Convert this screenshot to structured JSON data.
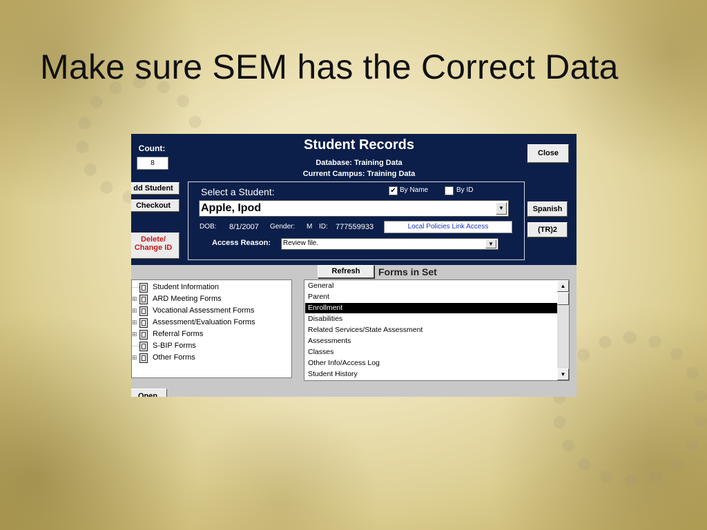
{
  "slide": {
    "title": "Make sure SEM has the Correct Data"
  },
  "app": {
    "count_label": "Count:",
    "count_value": "8",
    "title": "Student Records",
    "database_line": "Database:  Training Data",
    "campus_line": "Current Campus:  Training Data",
    "buttons": {
      "close": "Close",
      "add_student": "dd Student",
      "checkout": "Checkout",
      "delete_line1": "Delete/",
      "delete_line2": "Change ID",
      "spanish": "Spanish",
      "tr2": "(TR)2",
      "refresh": "Refresh",
      "open": "Open"
    },
    "select_student": {
      "label": "Select a Student:",
      "by_name_label": "By Name",
      "by_name_checked": true,
      "by_id_label": "By ID",
      "by_id_checked": false,
      "selected": "Apple, Ipod"
    },
    "student_info": {
      "dob_label": "DOB:",
      "dob_value": "8/1/2007",
      "gender_label": "Gender:",
      "gender_value": "M",
      "id_label": "ID:",
      "id_value": "777559933",
      "link_text": "Local Policies Link Access"
    },
    "access_reason": {
      "label": "Access Reason:",
      "value": "Review file."
    },
    "tree": [
      {
        "label": "Student Information"
      },
      {
        "label": "ARD Meeting Forms"
      },
      {
        "label": "Vocational Assessment Forms"
      },
      {
        "label": "Assessment/Evaluation Forms"
      },
      {
        "label": "Referral Forms"
      },
      {
        "label": "S-BIP Forms"
      },
      {
        "label": "Other Forms"
      }
    ],
    "forms_title": "Forms in Set",
    "forms": [
      {
        "label": "General"
      },
      {
        "label": "Parent"
      },
      {
        "label": "Enrollment",
        "selected": true
      },
      {
        "label": "Disabilities"
      },
      {
        "label": "Related Services/State Assessment"
      },
      {
        "label": "Assessments"
      },
      {
        "label": "Classes"
      },
      {
        "label": "Other Info/Access Log"
      },
      {
        "label": "Student History"
      }
    ],
    "colors": {
      "header_bg": "#0b1f4a",
      "selection_bg": "#000000",
      "link": "#1b34b8",
      "danger": "#c21818"
    }
  }
}
